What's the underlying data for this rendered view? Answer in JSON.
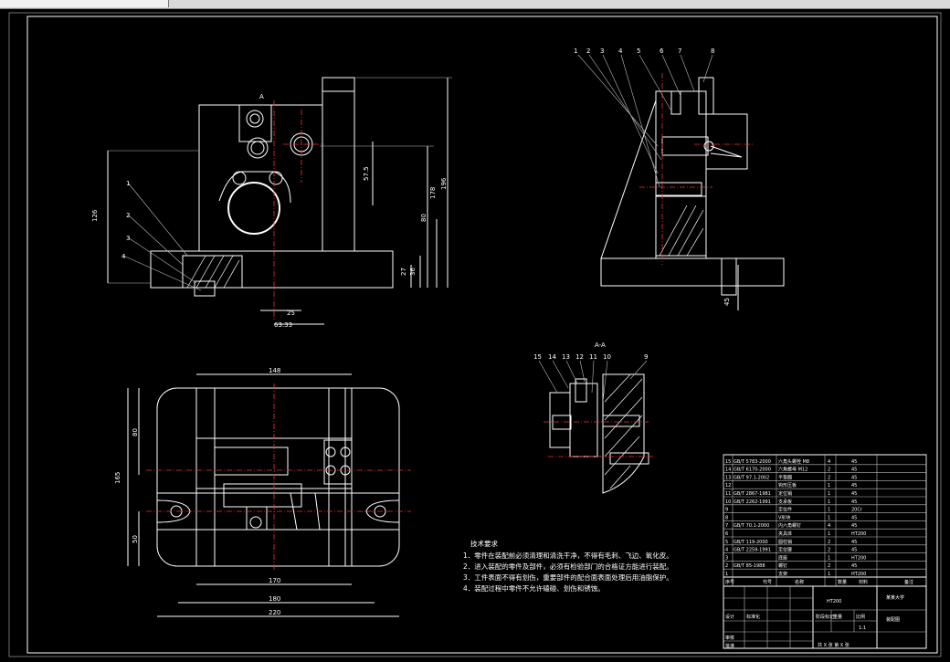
{
  "drawing": {
    "section_label": "A-A",
    "view_marker": "A",
    "dims_front": {
      "d1": "126",
      "d2": "57.5",
      "d3": "178",
      "d4": "80",
      "d5": "196",
      "d6": "27",
      "d7": "36",
      "d8": "25",
      "d9": "63.33"
    },
    "dims_plan": {
      "w_top": "148",
      "h_total": "165",
      "h_upper": "80",
      "h_lower": "50",
      "w1": "170",
      "w2": "180",
      "w3": "220"
    },
    "dims_side": {
      "d1": "45"
    },
    "callouts_front": [
      "1",
      "2",
      "3",
      "4"
    ],
    "callouts_side": [
      "1",
      "2",
      "3",
      "4",
      "5",
      "6",
      "7",
      "8"
    ],
    "callouts_section": [
      "15",
      "14",
      "13",
      "12",
      "11",
      "10",
      "9"
    ]
  },
  "tech_notes": {
    "title": "技术要求",
    "items": [
      "1．零件在装配前必须清理和清洗干净，不得有毛刺、飞边、氧化皮。",
      "2．进入装配的零件及部件，必须有检验部门的合格证方能进行装配。",
      "3．工件表面不得有划伤，重要部件的配合面表面处理后用油脂保护。",
      "4．装配过程中零件不允许磕碰、划伤和锈蚀。"
    ]
  },
  "title_block": {
    "material": "HT200",
    "scale": "1:1",
    "school": "某某大学",
    "drawing_name": "装配图",
    "sheet_info": "共 X 张  第 X 张",
    "drawing_no": "",
    "parts_rows": [
      {
        "no": "15",
        "code": "GB/T 5783-2000",
        "name": "六角头螺栓 M8",
        "qty": "4",
        "mat": "45"
      },
      {
        "no": "14",
        "code": "GB/T 6170-2000",
        "name": "六角螺母 M12",
        "qty": "2",
        "mat": "45"
      },
      {
        "no": "13",
        "code": "GB/T 97.1-2002",
        "name": "平垫圈",
        "qty": "2",
        "mat": "45"
      },
      {
        "no": "12",
        "code": "",
        "name": "钩形压板",
        "qty": "1",
        "mat": "45"
      },
      {
        "no": "11",
        "code": "GB/T 2867-1981",
        "name": "定位销",
        "qty": "1",
        "mat": "45"
      },
      {
        "no": "10",
        "code": "GB/T 2262-1991",
        "name": "支承板",
        "qty": "1",
        "mat": "45"
      },
      {
        "no": "9",
        "code": "",
        "name": "定位件",
        "qty": "1",
        "mat": "20Cr"
      },
      {
        "no": "8",
        "code": "",
        "name": "V形块",
        "qty": "1",
        "mat": "45"
      },
      {
        "no": "7",
        "code": "GB/T 70.1-2000",
        "name": "内六角螺钉",
        "qty": "4",
        "mat": "45"
      },
      {
        "no": "6",
        "code": "",
        "name": "夹具体",
        "qty": "1",
        "mat": "HT200"
      },
      {
        "no": "5",
        "code": "GB/T 119-2000",
        "name": "圆柱销",
        "qty": "2",
        "mat": "45"
      },
      {
        "no": "4",
        "code": "GB/T 2259-1991",
        "name": "定位键",
        "qty": "2",
        "mat": "45"
      },
      {
        "no": "3",
        "code": "",
        "name": "底座",
        "qty": "1",
        "mat": "HT200"
      },
      {
        "no": "2",
        "code": "GB/T 85-1988",
        "name": "螺钉",
        "qty": "2",
        "mat": "45"
      },
      {
        "no": "1",
        "code": "",
        "name": "支架",
        "qty": "1",
        "mat": "HT200"
      }
    ],
    "header": {
      "no": "序号",
      "code": "代号",
      "name": "名称",
      "qty": "数量",
      "mat": "材料",
      "note": "备注"
    },
    "labels": {
      "design": "设计",
      "check": "审核",
      "approve": "批准",
      "standard": "标准化",
      "stage": "阶段标记",
      "weight": "重量",
      "scale": "比例"
    }
  }
}
